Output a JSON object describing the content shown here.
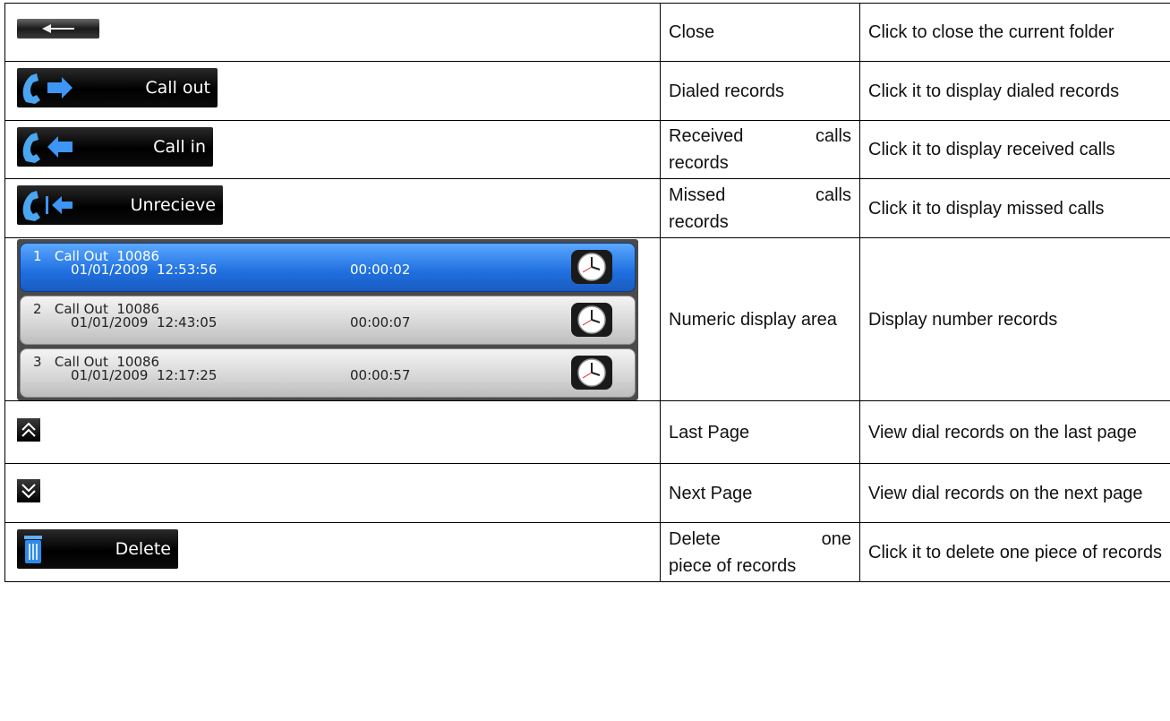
{
  "rows": [
    {
      "name": "Close",
      "desc": "Click to close the current folder"
    },
    {
      "name": "Dialed records",
      "desc": "Click it to display dialed records",
      "button_label": "Call out"
    },
    {
      "name_lines": [
        "Received calls",
        "records"
      ],
      "desc": "Click it to display received calls",
      "button_label": "Call in"
    },
    {
      "name_lines": [
        "Missed calls",
        "records"
      ],
      "desc": "Click it to display missed calls",
      "button_label": "Unrecieve"
    },
    {
      "name": "Numeric display area",
      "desc": "Display number records"
    },
    {
      "name": "Last Page",
      "desc": "View dial records on the last page"
    },
    {
      "name": "Next Page",
      "desc": "View dial records on the next page"
    },
    {
      "name_lines": [
        "Delete one",
        "piece of records"
      ],
      "desc": "Click it to delete one piece of records",
      "button_label": "Delete"
    }
  ],
  "records": [
    {
      "index": "1",
      "type": "Call Out",
      "number": "10086",
      "date": "01/01/2009",
      "time": "12:53:56",
      "duration": "00:00:02",
      "selected": true
    },
    {
      "index": "2",
      "type": "Call Out",
      "number": "10086",
      "date": "01/01/2009",
      "time": "12:43:05",
      "duration": "00:00:07",
      "selected": false
    },
    {
      "index": "3",
      "type": "Call Out",
      "number": "10086",
      "date": "01/01/2009",
      "time": "12:17:25",
      "duration": "00:00:57",
      "selected": false
    }
  ],
  "icons": {
    "close": "back-arrow-icon",
    "call_out": "phone-outgoing-icon",
    "call_in": "phone-incoming-icon",
    "missed": "phone-missed-icon",
    "clock": "clock-icon",
    "last_page": "double-chevron-up-icon",
    "next_page": "double-chevron-down-icon",
    "delete": "trash-icon"
  },
  "colors": {
    "phone": "#4aa6f0",
    "arrow": "#3d95f5",
    "selected_record": "#1f6fe0",
    "button_bg": "#000000"
  }
}
